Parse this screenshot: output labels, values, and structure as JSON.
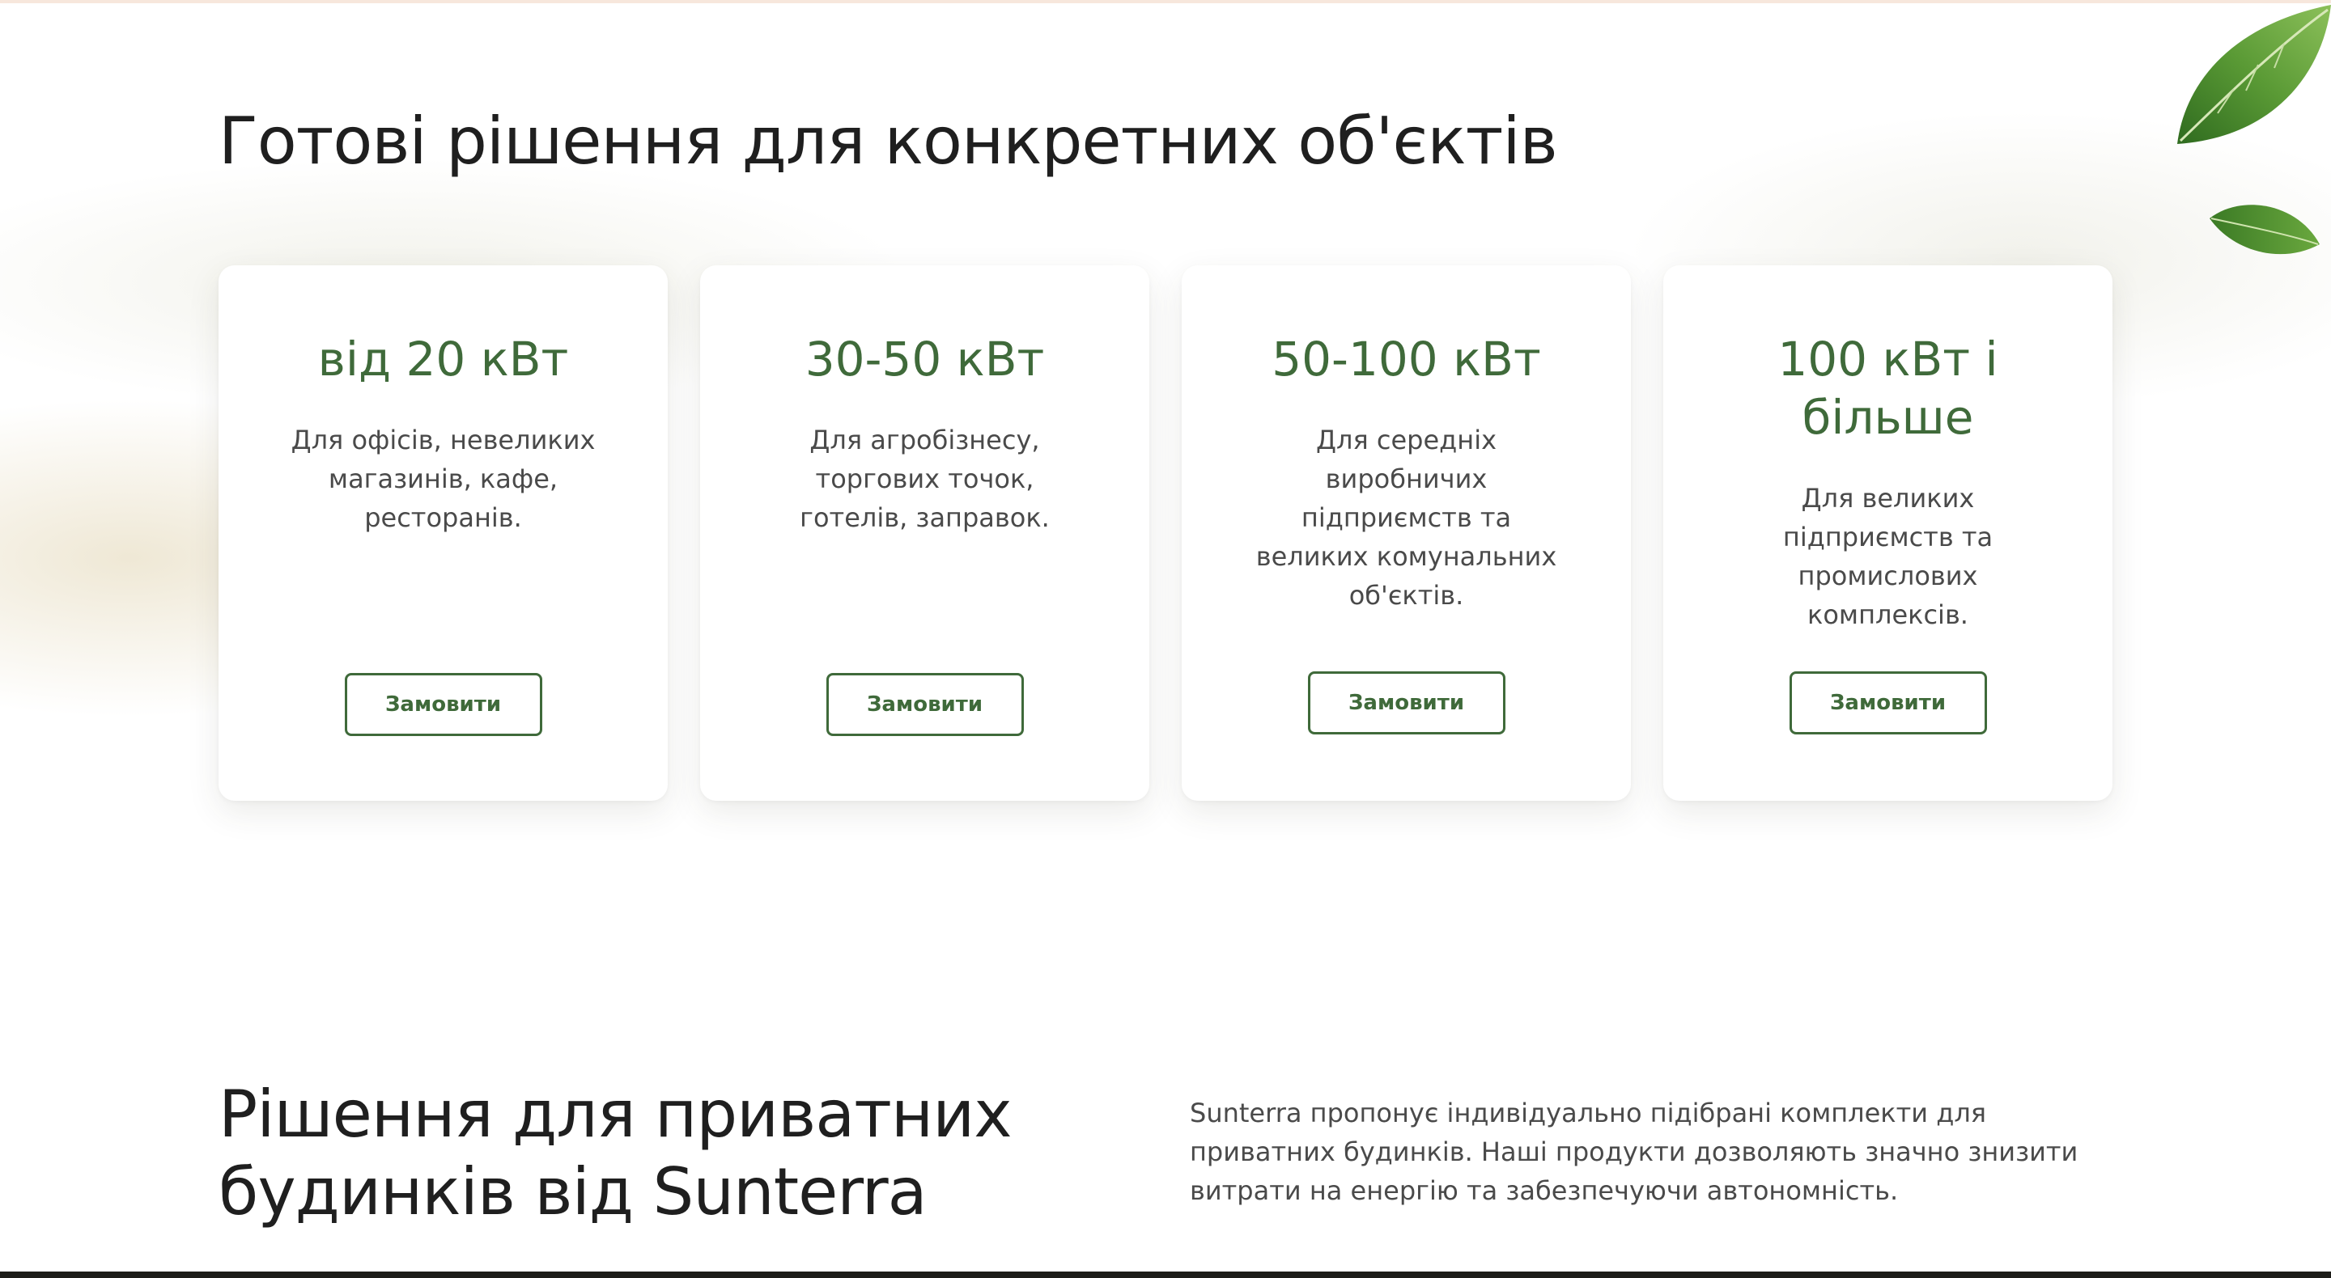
{
  "page": {
    "accent_color": "#3f6a3a",
    "text_color": "#1f1f1f"
  },
  "solutions": {
    "title": "Готові рішення для конкретних об'єктів",
    "cards": [
      {
        "title": "від 20 кВт",
        "description": "Для офісів, невеликих магазинів, кафе, ресторанів.",
        "button_label": "Замовити"
      },
      {
        "title": "30-50 кВт",
        "description": "Для агробізнесу, торгових точок, готелів, заправок.",
        "button_label": "Замовити"
      },
      {
        "title": "50-100 кВт",
        "description": "Для середніх виробничих підприємств та великих комунальних об'єктів.",
        "button_label": "Замовити"
      },
      {
        "title": "100 кВт і більше",
        "description": "Для великих підприємств та промислових комплексів.",
        "button_label": "Замовити"
      }
    ]
  },
  "private": {
    "title": "Рішення для приватних будинків від Sunterra",
    "description": "Sunterra пропонує індивідуально підібрані комплекти для приватних будинків. Наші продукти дозволяють значно знизити витрати на енергію та забезпечуючи автономність."
  },
  "decor": {
    "leaf_icon": "leaf-icon"
  }
}
